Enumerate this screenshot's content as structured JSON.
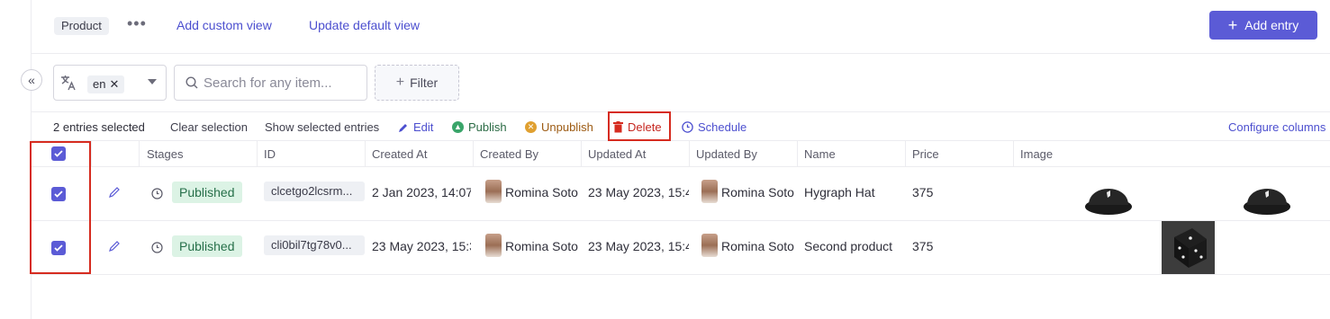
{
  "topbar": {
    "view_tag": "Product",
    "more_label": "•••",
    "add_custom_view": "Add custom view",
    "update_default_view": "Update default view",
    "add_entry": "Add entry"
  },
  "toolbar": {
    "locale_value": "en",
    "search_placeholder": "Search for any item...",
    "filter_label": "Filter"
  },
  "actionbar": {
    "selected_count": "2 entries selected",
    "clear_selection": "Clear selection",
    "show_selected": "Show selected entries",
    "edit": "Edit",
    "publish": "Publish",
    "unpublish": "Unpublish",
    "delete": "Delete",
    "schedule": "Schedule",
    "configure_columns": "Configure columns"
  },
  "columns": {
    "stages": "Stages",
    "id": "ID",
    "created_at": "Created At",
    "created_by": "Created By",
    "updated_at": "Updated At",
    "updated_by": "Updated By",
    "name": "Name",
    "price": "Price",
    "image": "Image"
  },
  "rows": [
    {
      "stage": "Published",
      "id": "clcetgo2lcsrm...",
      "created_at": "2 Jan 2023, 14:07",
      "created_by": "Romina Soto",
      "updated_at": "23 May 2023, 15:4",
      "updated_by": "Romina Soto",
      "name": "Hygraph Hat",
      "price": "375"
    },
    {
      "stage": "Published",
      "id": "cli0bil7tg78v0...",
      "created_at": "23 May 2023, 15:3",
      "created_by": "Romina Soto",
      "updated_at": "23 May 2023, 15:4",
      "updated_by": "Romina Soto",
      "name": "Second product",
      "price": "375"
    }
  ],
  "colors": {
    "accent": "#5b5bd6",
    "highlight": "#d62b1f",
    "published_bg": "#dcf3e5"
  }
}
